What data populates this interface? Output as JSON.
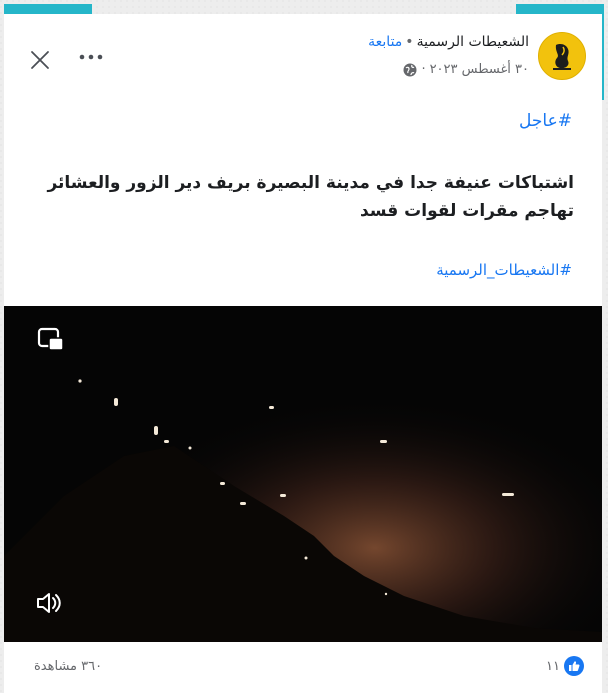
{
  "post": {
    "page_name": "الشعيطات الرسمية",
    "separator": "•",
    "follow_label": "متابعة",
    "date": "٣٠ أغسطس ٢٠٢٣",
    "date_separator": "·",
    "hashtag_top": "#عاجل",
    "body_line1": "اشتباكات عنيفة جدا في مدينة البصيرة بريف دير الزور والعشائر",
    "body_line2": "تهاجم مقرات لقوات قسد",
    "hashtag_bottom": "#الشعيطات_الرسمية"
  },
  "icons": {
    "close": "close-icon",
    "more": "more-options-icon",
    "privacy": "globe-icon",
    "pip": "picture-in-picture-icon",
    "sound": "speaker-icon",
    "like": "like-icon"
  },
  "footer": {
    "views": "٣٦٠ مشاهدة",
    "reaction_count": "١١"
  },
  "colors": {
    "accent": "#25b6c9",
    "link": "#1877f2",
    "avatar": "#f2c20d"
  }
}
